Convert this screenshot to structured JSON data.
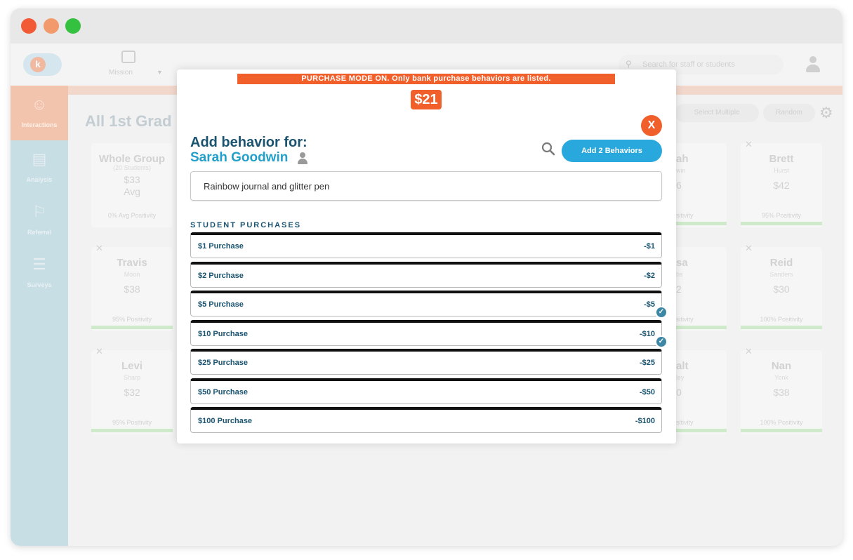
{
  "window": {
    "controls": [
      "close",
      "minimize",
      "maximize"
    ]
  },
  "topbar": {
    "logo_letter": "k",
    "school_label": "Mission",
    "search_placeholder": "Search for staff or students"
  },
  "sidebar": {
    "items": [
      {
        "label": "Interactions",
        "icon": "interactions-icon",
        "active": true
      },
      {
        "label": "Analysis",
        "icon": "chart-icon",
        "active": false
      },
      {
        "label": "Referral",
        "icon": "flag-icon",
        "active": false
      },
      {
        "label": "Surveys",
        "icon": "clipboard-icon",
        "active": false
      }
    ]
  },
  "page": {
    "title": "All 1st Grad",
    "buttons": [
      "Select Multiple",
      "Random"
    ]
  },
  "cards": [
    {
      "name": "Whole Group",
      "sub": "(20 Students)",
      "amount": "$33",
      "amount2": "Avg",
      "positivity": "0% Avg Positivity"
    },
    {
      "name": "Travis",
      "sub": "Moon",
      "amount": "$38",
      "positivity": "95% Positivity"
    },
    {
      "name": "Levi",
      "sub": "Sharp",
      "amount": "$32",
      "positivity": "95% Positivity"
    },
    {
      "name": "ah",
      "sub": "win",
      "amount": "6",
      "positivity": "sitivity"
    },
    {
      "name": "sa",
      "sub": "bs",
      "amount": "2",
      "positivity": "sitivity"
    },
    {
      "name": "alt",
      "sub": "ley",
      "amount": "0",
      "positivity": "sitivity"
    },
    {
      "name": "Brett",
      "sub": "Hurst",
      "amount": "$42",
      "positivity": "95% Positivity"
    },
    {
      "name": "Reid",
      "sub": "Sanders",
      "amount": "$30",
      "positivity": "100% Positivity"
    },
    {
      "name": "Nan",
      "sub": "Yonk",
      "amount": "$38",
      "positivity": "100% Positivity"
    }
  ],
  "modal": {
    "banner": "PURCHASE MODE ON.  Only bank purchase behaviors are listed.",
    "balance": "$21",
    "close_label": "X",
    "heading": "Add behavior for:",
    "student_name": "Sarah Goodwin",
    "add_button": "Add 2 Behaviors",
    "note_value": "Rainbow journal and glitter pen",
    "section_title": "STUDENT PURCHASES",
    "purchases": [
      {
        "label": "$1 Purchase",
        "amount": "-$1",
        "selected": false
      },
      {
        "label": "$2 Purchase",
        "amount": "-$2",
        "selected": false
      },
      {
        "label": "$5 Purchase",
        "amount": "-$5",
        "selected": true
      },
      {
        "label": "$10 Purchase",
        "amount": "-$10",
        "selected": true
      },
      {
        "label": "$25 Purchase",
        "amount": "-$25",
        "selected": false
      },
      {
        "label": "$50 Purchase",
        "amount": "-$50",
        "selected": false
      },
      {
        "label": "$100 Purchase",
        "amount": "-$100",
        "selected": false
      }
    ]
  },
  "colors": {
    "accent_orange": "#f15f2b",
    "accent_blue": "#29a8dd",
    "navy": "#1a5470",
    "check_blue": "#3d87a6"
  }
}
